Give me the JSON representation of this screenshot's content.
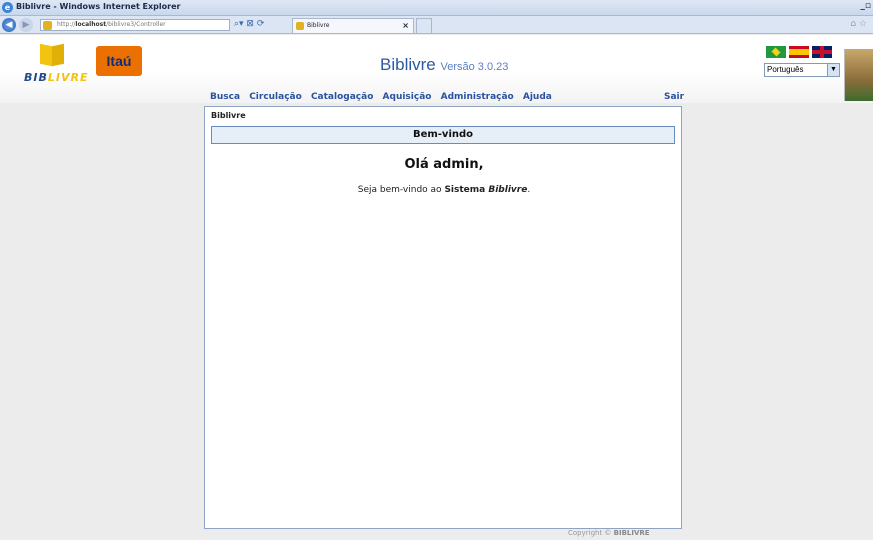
{
  "browser": {
    "window_title": "Biblivre - Windows Internet Explorer",
    "address_prefix": "http://",
    "address_host": "localhost",
    "address_path": "/biblivre3/Controller",
    "tab_label": "Biblivre",
    "tab_close": "×"
  },
  "header": {
    "brand_prefix": "BIB",
    "brand_suffix": "LIVRE",
    "sponsor": "Itaú",
    "app_name": "Biblivre",
    "version": "Versão 3.0.23",
    "language_selected": "Português"
  },
  "menu": {
    "items": [
      "Busca",
      "Circulação",
      "Catalogação",
      "Aquisição",
      "Administração",
      "Ajuda"
    ],
    "logout": "Sair"
  },
  "content": {
    "breadcrumb": "Biblivre",
    "box_title": "Bem-vindo",
    "greeting": "Olá admin,",
    "welcome_prefix": "Seja bem-vindo ao ",
    "welcome_bold": "Sistema ",
    "welcome_italic": "Biblivre",
    "welcome_end": "."
  },
  "footer": {
    "copyright_prefix": "Copyright © ",
    "copyright_owner": "BIBLIVRE"
  }
}
